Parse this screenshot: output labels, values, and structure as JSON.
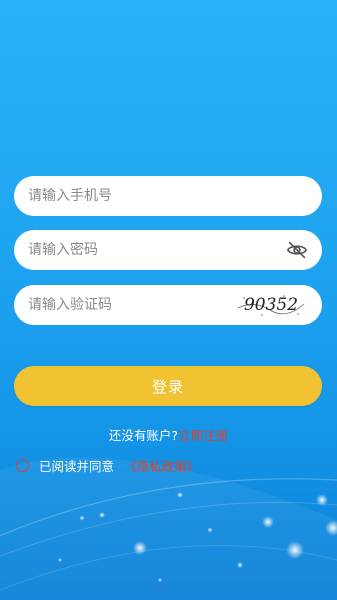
{
  "form": {
    "phone_placeholder": "请输入手机号",
    "password_placeholder": "请输入密码",
    "code_placeholder": "请输入验证码",
    "captcha_text": "90352"
  },
  "login_button": "登录",
  "register": {
    "prompt": "还没有账户?",
    "link": "立即注册"
  },
  "agreement": {
    "text": "已阅读并同意",
    "policy_link": "《隐私政策》",
    "checked": false
  },
  "colors": {
    "background": "#1ea3f0",
    "button": "#f1c232",
    "link": "#e2402a"
  }
}
